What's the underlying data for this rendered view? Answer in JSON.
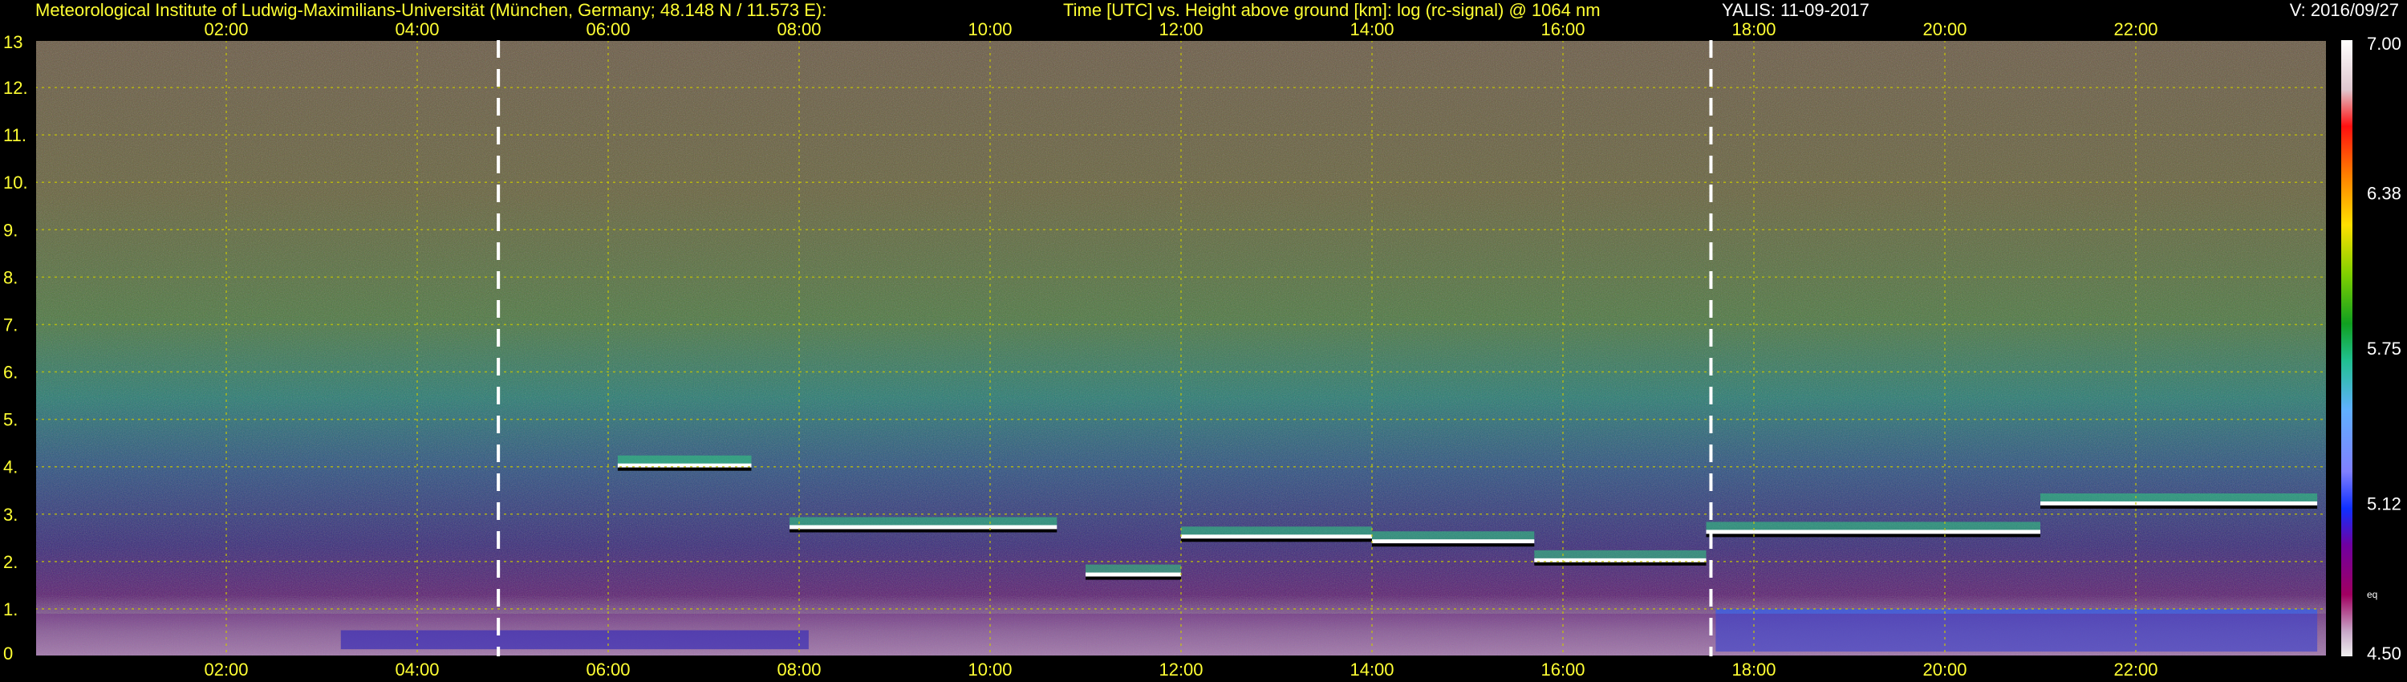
{
  "header": {
    "institute": "Meteorological Institute of Ludwig-Maximilians-Universität (München, Germany; 48.148 N / 11.573 E):",
    "plot_title": "Time [UTC] vs. Height above ground [km]: log (rc-signal) @ 1064 nm",
    "instrument_date": "YALIS: 11-09-2017",
    "version": "V: 2016/09/27"
  },
  "colors": {
    "text_yellow": "#ffff33",
    "text_white": "#ffffff",
    "grid": "#c8c800",
    "marker_line": "#ffffff",
    "background": "#000000"
  },
  "chart_data": {
    "type": "heatmap",
    "title": "Time [UTC] vs. Height above ground [km]: log (rc-signal) @ 1064 nm",
    "xlabel": "Time [UTC]",
    "ylabel": "Height above ground [km]",
    "x_ticks": [
      "02:00",
      "04:00",
      "06:00",
      "08:00",
      "10:00",
      "12:00",
      "14:00",
      "16:00",
      "18:00",
      "20:00",
      "22:00"
    ],
    "x_tick_hours": [
      2,
      4,
      6,
      8,
      10,
      12,
      14,
      16,
      18,
      20,
      22
    ],
    "xlim_hours": [
      0,
      24
    ],
    "y_ticks": [
      "0",
      "1.",
      "2.",
      "3.",
      "4.",
      "5.",
      "6.",
      "7.",
      "8.",
      "9.",
      "10.",
      "11.",
      "12.",
      "13"
    ],
    "ylim": [
      0,
      13
    ],
    "grid": true,
    "marker_lines_hours": [
      4.85,
      17.55
    ],
    "colorbar": {
      "range": [
        4.5,
        7.0
      ],
      "labels": [
        "7.00",
        "6.38",
        "5.75",
        "5.12",
        "4.50"
      ],
      "label_values": [
        7.0,
        6.38,
        5.75,
        5.12,
        4.5
      ],
      "extra_label": "eq",
      "colors": [
        "#ffffff",
        "#e0d8e0",
        "#ff2020",
        "#ff8000",
        "#ffcc00",
        "#ffff00",
        "#80e000",
        "#10b010",
        "#20c080",
        "#40d0c0",
        "#60b0ff",
        "#8080ff",
        "#2040ff",
        "#8000a0",
        "#a00070",
        "#c090c0",
        "#ffffff"
      ]
    },
    "cloud_layers": [
      {
        "start_h": 6.1,
        "end_h": 7.5,
        "height_km": 4.0
      },
      {
        "start_h": 7.9,
        "end_h": 10.7,
        "height_km": 2.7
      },
      {
        "start_h": 11.0,
        "end_h": 12.0,
        "height_km": 1.7
      },
      {
        "start_h": 12.0,
        "end_h": 14.0,
        "height_km": 2.5
      },
      {
        "start_h": 14.0,
        "end_h": 15.7,
        "height_km": 2.4
      },
      {
        "start_h": 15.7,
        "end_h": 17.5,
        "height_km": 2.0
      },
      {
        "start_h": 17.5,
        "end_h": 21.0,
        "height_km": 2.6
      },
      {
        "start_h": 21.0,
        "end_h": 23.9,
        "height_km": 3.2
      }
    ],
    "boundary_layer_km": 0.9
  }
}
